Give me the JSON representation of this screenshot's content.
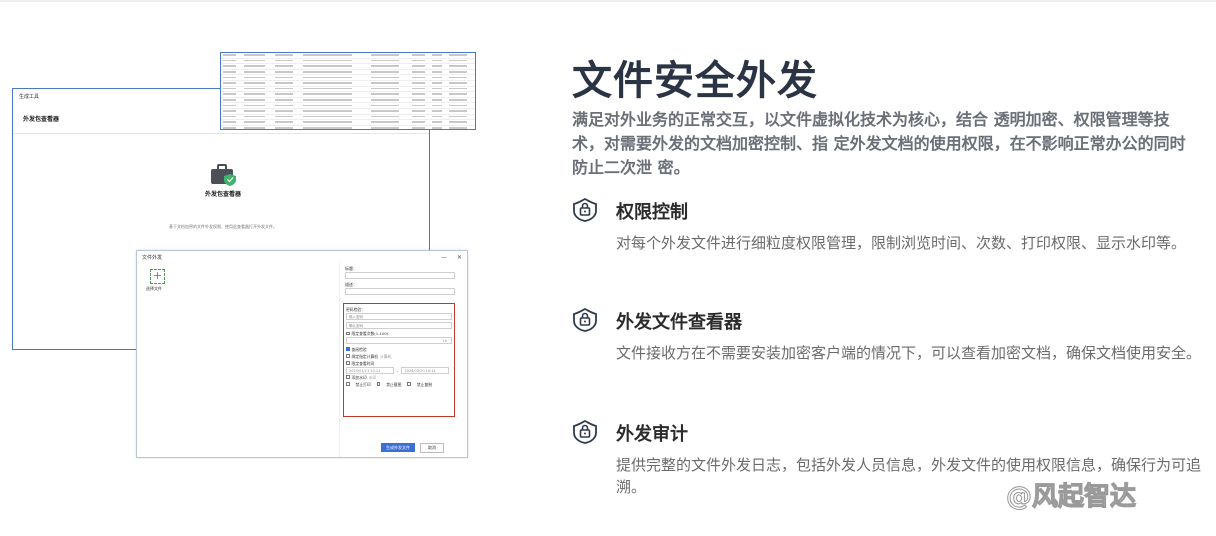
{
  "heading": {
    "title": "文件安全外发",
    "intro": "满足对外业务的正常交互，以文件虚拟化技术为核心，结合 透明加密、权限管理等技术，对需要外发的文档加密控制、指 定外发文档的使用权限，在不影响正常办公的同时防止二次泄 密。"
  },
  "features": [
    {
      "icon": "shield-lock-icon",
      "title": "权限控制",
      "desc": "对每个外发文件进行细粒度权限管理，限制浏览时间、次数、打印权限、显示水印等。"
    },
    {
      "icon": "shield-lock-icon",
      "title": "外发文件查看器",
      "desc": "文件接收方在不需要安装加密客户端的情况下，可以查看加密文档，确保文档使用安全。"
    },
    {
      "icon": "shield-lock-icon",
      "title": "外发审计",
      "desc": "提供完整的文件外发日志，包括外发人员信息，外发文件的使用权限信息，确保行为可追溯。"
    }
  ],
  "watermark": {
    "text": "@风起智达"
  },
  "screenshot": {
    "tool_window": {
      "title": "生成工具",
      "subtitle": "外发包查看器",
      "center_title": "外发包查看器",
      "center_desc": "基于文档加密的文件外发权限、使用此查看器打开外发文件。"
    },
    "send_dialog": {
      "title": "文件外发",
      "select_file": "选择文件",
      "fields": {
        "title_label": "标题：",
        "desc_label": "描述："
      },
      "permissions": {
        "open_check": "密码检验：",
        "pwd_placeholder": "输入密码",
        "pwd_confirm": "确认密码",
        "limit_views": "限定查看次数(1-100)",
        "views_value": "10",
        "check_after_open": "查阅检验",
        "bind_machine": "绑定指定计算机",
        "machine_hint": "计算机",
        "limit_time": "限定查看时间",
        "start_time": "2024/01/11 10:11",
        "end_time": "2024/03/20 10:11",
        "watermark_opt": "添加水印",
        "watermark_hint": "水印",
        "no_print": "禁止打印",
        "no_screenshot": "禁止截图",
        "no_copy": "禁止复制"
      },
      "confirm_btn": "生成外发文件",
      "cancel_btn": "取消"
    }
  }
}
